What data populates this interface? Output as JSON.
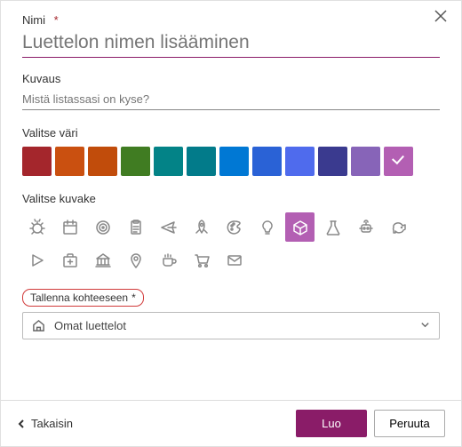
{
  "header": {
    "name_label": "Nimi",
    "required_mark": "*",
    "name_placeholder": "Luettelon nimen lisääminen"
  },
  "description": {
    "label": "Kuvaus",
    "placeholder": "Mistä listassasi on kyse?"
  },
  "color": {
    "label": "Valitse väri",
    "options": [
      "#a4262c",
      "#ca5010",
      "#c14c0b",
      "#407c22",
      "#038387",
      "#027b8a",
      "#0078d4",
      "#2a62d6",
      "#4f6bed",
      "#3a3a8f",
      "#8764b8",
      "#b35fb3"
    ],
    "selected_index": 11
  },
  "icon": {
    "label": "Valitse kuvake",
    "options": [
      "bug",
      "calendar",
      "target",
      "clipboard",
      "airplane",
      "rocket",
      "palette",
      "lightbulb",
      "cube",
      "beaker",
      "robot",
      "piggybank",
      "play",
      "firstaid",
      "bank",
      "pin",
      "coffee",
      "cart",
      "mail"
    ],
    "selected_index": 8
  },
  "save": {
    "label": "Tallenna kohteeseen",
    "required_mark": "*",
    "selected": "Omat luettelot"
  },
  "footer": {
    "back": "Takaisin",
    "create": "Luo",
    "cancel": "Peruuta"
  }
}
